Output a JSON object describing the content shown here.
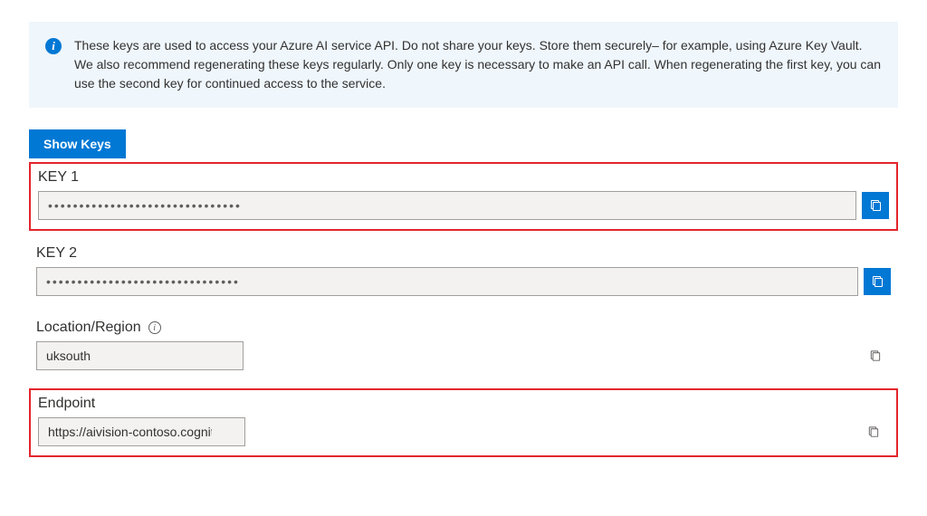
{
  "banner": {
    "text": "These keys are used to access your Azure AI service API. Do not share your keys. Store them securely– for example, using Azure Key Vault. We also recommend regenerating these keys regularly. Only one key is necessary to make an API call. When regenerating the first key, you can use the second key for continued access to the service."
  },
  "buttons": {
    "show_keys": "Show Keys"
  },
  "fields": {
    "key1": {
      "label": "KEY 1",
      "value": "•••••••••••••••••••••••••••••••"
    },
    "key2": {
      "label": "KEY 2",
      "value": "•••••••••••••••••••••••••••••••"
    },
    "location": {
      "label": "Location/Region",
      "value": "uksouth"
    },
    "endpoint": {
      "label": "Endpoint",
      "value": "https://aivision-contoso.cognitiveservices.azure.com/"
    }
  },
  "colors": {
    "primary": "#0078d4",
    "highlight_border": "#e3252d",
    "banner_bg": "#eff6fc"
  }
}
